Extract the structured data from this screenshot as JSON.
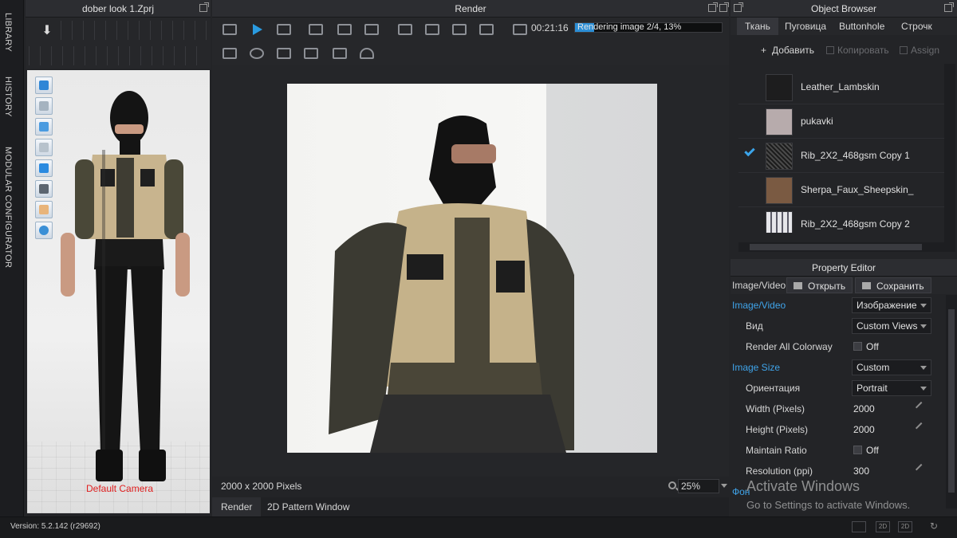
{
  "sidebar": {
    "tabs": [
      "LIBRARY",
      "HISTORY",
      "MODULAR CONFIGURATOR"
    ]
  },
  "left_panel": {
    "title": "dober look 1.Zprj",
    "camera_label": "Default Camera"
  },
  "render_panel": {
    "title": "Render",
    "timer": "00:21:16",
    "progress_text": "Rendering image 2/4, 13%",
    "progress_fraction": 0.13,
    "image_size_label": "2000 x 2000 Pixels",
    "zoom": "25%",
    "bottom_tabs": [
      "Render",
      "2D Pattern Window"
    ]
  },
  "object_browser": {
    "title": "Object Browser",
    "tabs": [
      "Ткань",
      "Пуговица",
      "Buttonhole",
      "Строчк"
    ],
    "actions": {
      "add": "Добавить",
      "copy": "Копировать",
      "assign": "Assign"
    },
    "items": [
      {
        "name": "Leather_Lambskin",
        "swatch": "#1d1d1e",
        "selected": false
      },
      {
        "name": "pukavki",
        "swatch": "#b7abac",
        "selected": false
      },
      {
        "name": "Rib_2X2_468gsm Copy 1",
        "swatch": "#2e2e2e",
        "selected": true
      },
      {
        "name": "Sherpa_Faux_Sheepskin_",
        "swatch": "#7a5a42",
        "selected": false
      },
      {
        "name": "Rib_2X2_468gsm Copy 2",
        "swatch": "#d8d8dc",
        "selected": false
      }
    ]
  },
  "property_editor": {
    "title": "Property Editor",
    "toolbar_label": "Image/Video",
    "open_label": "Открыть",
    "save_label": "Сохранить",
    "rows": {
      "r0": {
        "label": "Image/Video",
        "value": "Изображение"
      },
      "r1": {
        "label": "Вид",
        "value": "Custom Views"
      },
      "r2": {
        "label": "Render All Colorway",
        "value": "Off"
      },
      "r3": {
        "label": "Image Size",
        "value": "Custom"
      },
      "r4": {
        "label": "Ориентация",
        "value": "Portrait"
      },
      "r5": {
        "label": "Width (Pixels)",
        "value": "2000"
      },
      "r6": {
        "label": "Height (Pixels)",
        "value": "2000"
      },
      "r7": {
        "label": "Maintain Ratio",
        "value": "Off"
      },
      "r8": {
        "label": "Resolution (ppi)",
        "value": "300"
      },
      "r9": {
        "label": "Фон",
        "value": ""
      }
    }
  },
  "watermark": {
    "line1": "Activate Windows",
    "line2": "Go to Settings to activate Windows."
  },
  "statusbar": {
    "version": "Version: 5.2.142 (r29692)",
    "view_buttons": [
      "",
      "2D",
      "2D"
    ]
  },
  "colors": {
    "accent": "#2b8ed6",
    "section": "#3fa4ea",
    "camera_label": "#e02020"
  }
}
